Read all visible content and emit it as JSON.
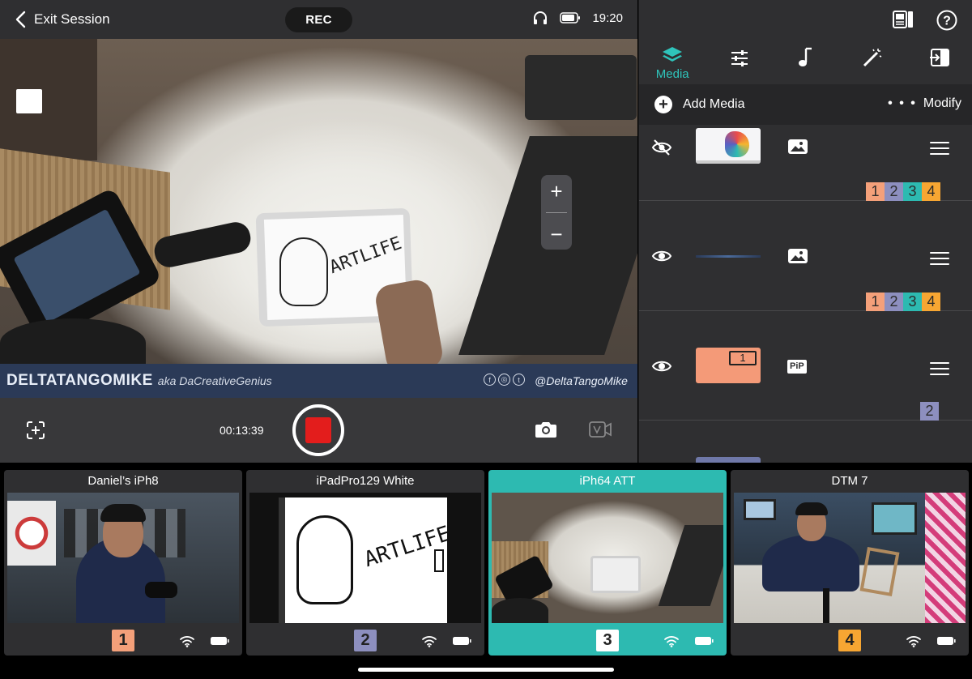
{
  "header": {
    "exit_label": "Exit Session",
    "rec_label": "REC",
    "time": "19:20"
  },
  "preview": {
    "name": "DELTATANGOMIKE",
    "aka": "aka DaCreativeGenius",
    "handle": "@DeltaTangoMike",
    "drawing_text": "ARTLIFE",
    "zoom_in": "+",
    "zoom_out": "−"
  },
  "controls": {
    "timer": "00:13:39",
    "rec_color": "#e31d1c"
  },
  "panel": {
    "tabs": [
      {
        "label": "Media",
        "icon": "layers-icon",
        "active": true
      },
      {
        "label": "",
        "icon": "sliders-icon"
      },
      {
        "label": "",
        "icon": "music-note-icon"
      },
      {
        "label": "",
        "icon": "magic-wand-icon"
      },
      {
        "label": "",
        "icon": "exit-session-icon"
      }
    ],
    "add_media_label": "Add Media",
    "modify_dots": "• • •",
    "modify_label": "Modify",
    "accent": "#2fc4bb",
    "media": [
      {
        "visible": false,
        "type": "image",
        "badges": [
          "1",
          "2",
          "3",
          "4"
        ]
      },
      {
        "visible": true,
        "type": "image",
        "badges": [
          "1",
          "2",
          "3",
          "4"
        ]
      },
      {
        "visible": true,
        "type": "PiP",
        "pip_num": "1",
        "badges": [
          "2"
        ]
      }
    ]
  },
  "sources": [
    {
      "name": "Daniel’s iPh8",
      "num": "1",
      "color": "#f4a07a",
      "active": false
    },
    {
      "name": "iPadPro129 White",
      "num": "2",
      "color": "#8d8fbf",
      "active": false,
      "drawing_text": "ARTLIFE"
    },
    {
      "name": "iPh64 ATT",
      "num": "3",
      "color": "#ffffff",
      "active": true
    },
    {
      "name": "DTM 7",
      "num": "4",
      "color": "#f7a632",
      "active": false
    }
  ],
  "badge_colors": [
    "#f4a07a",
    "#8d8fbf",
    "#2dbab1",
    "#f7a632"
  ]
}
